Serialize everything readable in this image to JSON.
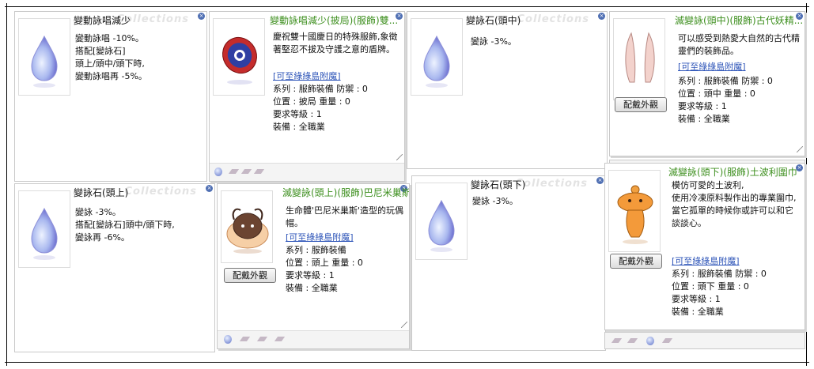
{
  "panels": {
    "p1": {
      "title": "變動詠唱減少",
      "watermark": "Collections",
      "desc": "變動詠唱 -10%。\n搭配[變詠石]\n 頭上/頭中/頭下時,\n變動詠唱再 -5%。"
    },
    "p2": {
      "title": "變動詠唱減少(披局)(服飾)雙...",
      "desc": "慶祝雙十國慶日的特殊服飾,象徵著堅忍不拔及守護之意的盾牌。",
      "link": "[可至綠綠島附魔]",
      "series": "系列 : 服飾裝備 防禦 : 0",
      "position": "位置 : 披局 重量 : 0",
      "level": "要求等級 : 1",
      "equip": "裝備 : 全職業"
    },
    "p3": {
      "title": "變詠石(頭中)",
      "watermark": "Collections",
      "desc": "變詠 -3%。"
    },
    "p4": {
      "title": "滅變詠(頭中)(服飾)古代妖精...",
      "desc": "可以感受到熱愛大自然的古代精靈們的裝飾品。",
      "link": "[可至綠綠島附魔]",
      "series": "系列 : 服飾裝備 防禦 : 0",
      "position": "位置 : 頭中 重量 : 0",
      "level": "要求等級 : 1",
      "equip": "裝備 : 全職業",
      "button": "配戴外觀"
    },
    "p5": {
      "title": "變詠石(頭上)",
      "watermark": "Collections",
      "desc": "變詠 -3%。\n搭配[變詠石]頭中/頭下時,\n變詠再 -6%。"
    },
    "p6": {
      "title": "滅變詠(頭上)(服飾)巴尼米巢斯...",
      "desc": "生命體'巴尼米巢斯'造型的玩偶帽。",
      "link": "[可至綠綠島附魔]",
      "series": "系列 : 服飾裝備",
      "position": "位置 : 頭上 重量 : 0",
      "level": "要求等級 : 1",
      "equip": "裝備 : 全職業",
      "button": "配戴外觀"
    },
    "p7": {
      "title": "變詠石(頭下)",
      "watermark": "Collections",
      "desc": "變詠 -3%。"
    },
    "p8": {
      "title": "滅變詠(頭下)(服飾)土波利圍巾",
      "desc": "模仿可愛的土波利,\n使用冷凍原料製作出的專業圍巾,\n當它孤單的時候你或許可以和它談談心。",
      "link": "[可至綠綠島附魔]",
      "series": "系列 : 服飾裝備 防禦 : 0",
      "position": "位置 : 頭下 重量 : 0",
      "level": "要求等級 : 1",
      "equip": "裝備 : 全職業",
      "button": "配戴外觀"
    }
  },
  "colors": {
    "title_green": "#3d8f1e",
    "link_blue": "#2d54b8",
    "close_blue": "#4f6fb3"
  }
}
